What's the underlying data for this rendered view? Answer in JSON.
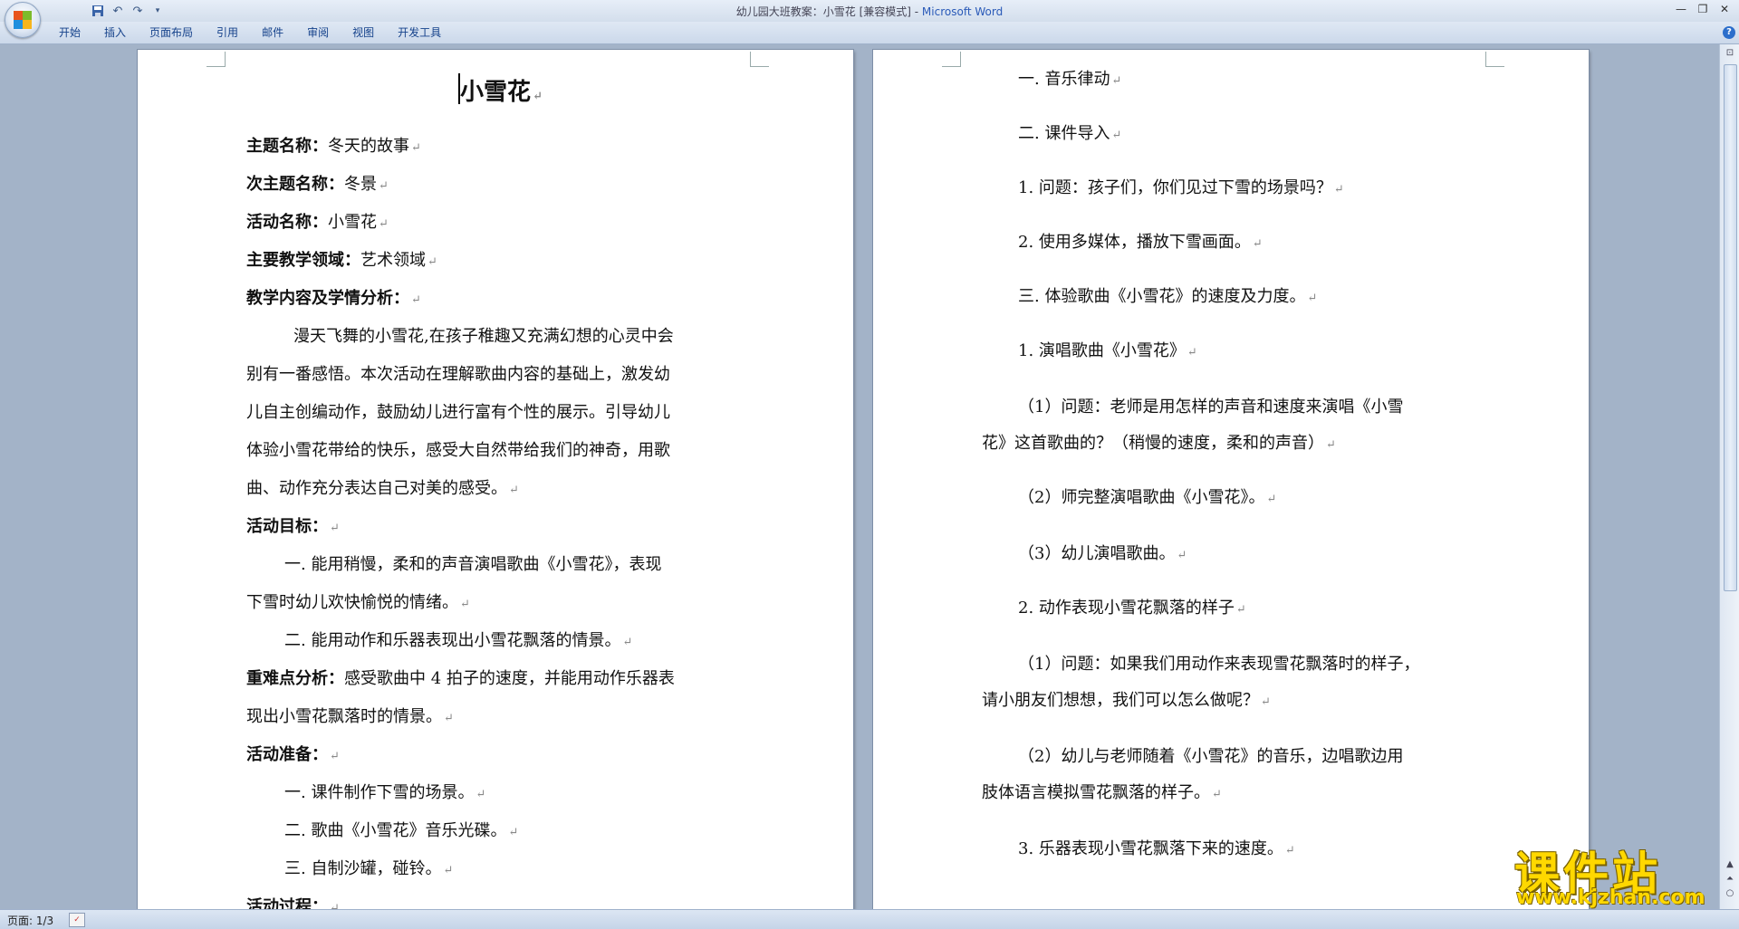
{
  "window": {
    "title_doc": "幼儿园大班教案：小雪花 [兼容模式] - ",
    "title_app": "Microsoft Word"
  },
  "quick_access": [
    "save-icon",
    "undo-icon",
    "redo-icon",
    "customize-icon"
  ],
  "ribbon": {
    "tabs": [
      "开始",
      "插入",
      "页面布局",
      "引用",
      "邮件",
      "审阅",
      "视图",
      "开发工具"
    ]
  },
  "page1": {
    "title": "小雪花",
    "lines": [
      {
        "label": "主题名称：",
        "text": "冬天的故事"
      },
      {
        "label": "次主题名称：",
        "text": "冬景"
      },
      {
        "label": "活动名称：",
        "text": "小雪花"
      },
      {
        "label": "主要教学领域：",
        "text": "艺术领域"
      },
      {
        "label": "教学内容及学情分析：",
        "text": ""
      },
      {
        "label": "",
        "text": "漫天飞舞的小雪花,在孩子稚趣又充满幻想的心灵中会"
      },
      {
        "label": "",
        "text": "别有一番感悟。本次活动在理解歌曲内容的基础上，激发幼"
      },
      {
        "label": "",
        "text": "儿自主创编动作，鼓励幼儿进行富有个性的展示。引导幼儿"
      },
      {
        "label": "",
        "text": "体验小雪花带给的快乐，感受大自然带给我们的神奇，用歌"
      },
      {
        "label": "",
        "text": "曲、动作充分表达自己对美的感受。"
      },
      {
        "label": "活动目标：",
        "text": ""
      },
      {
        "label": "",
        "text": "一. 能用稍慢，柔和的声音演唱歌曲《小雪花》，表现"
      },
      {
        "label": "",
        "text": "下雪时幼儿欢快愉悦的情绪。"
      },
      {
        "label": "",
        "text": "二. 能用动作和乐器表现出小雪花飘落的情景。"
      },
      {
        "label": "重难点分析：",
        "text": "感受歌曲中 4 拍子的速度，并能用动作乐器表"
      },
      {
        "label": "",
        "text": "现出小雪花飘落时的情景。"
      },
      {
        "label": "活动准备：",
        "text": ""
      },
      {
        "label": "",
        "text": "一. 课件制作下雪的场景。"
      },
      {
        "label": "",
        "text": "二. 歌曲《小雪花》音乐光碟。"
      },
      {
        "label": "",
        "text": "三. 自制沙罐，碰铃。"
      },
      {
        "label": "活动过程：",
        "text": ""
      }
    ]
  },
  "page2": {
    "lines": [
      "一. 音乐律动",
      "二. 课件导入",
      "1. 问题：孩子们，你们见过下雪的场景吗？",
      "2. 使用多媒体，播放下雪画面。",
      "三. 体验歌曲《小雪花》的速度及力度。",
      "1. 演唱歌曲《小雪花》",
      "（1）问题：老师是用怎样的声音和速度来演唱《小雪",
      "花》这首歌曲的？（稍慢的速度，柔和的声音）",
      "（2）师完整演唱歌曲《小雪花》。",
      "（3）幼儿演唱歌曲。",
      "2. 动作表现小雪花飘落的样子",
      "（1）问题：如果我们用动作来表现雪花飘落时的样子，",
      "请小朋友们想想，我们可以怎么做呢？",
      "（2）幼儿与老师随着《小雪花》的音乐，边唱歌边用",
      "肢体语言模拟雪花飘落的样子。",
      "3. 乐器表现小雪花飘落下来的速度。"
    ]
  },
  "status": {
    "page": "页面: 1/3"
  },
  "watermark": {
    "logo": "课件站",
    "url": "www.kjzhan.com"
  }
}
